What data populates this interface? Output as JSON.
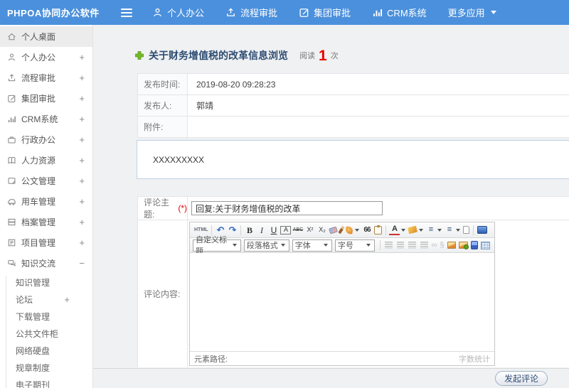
{
  "colors": {
    "header_blue": "#4b90dc",
    "title_navy": "#2e4d72",
    "count_red": "#e60000",
    "plus_green": "#6ab024"
  },
  "header": {
    "logo": "PHPOA协同办公软件",
    "nav": [
      {
        "label": "个人办公"
      },
      {
        "label": "流程审批"
      },
      {
        "label": "集团审批"
      },
      {
        "label": "CRM系统"
      },
      {
        "label": "更多应用"
      }
    ]
  },
  "sidebar": {
    "items": [
      {
        "label": "个人桌面",
        "expand": ""
      },
      {
        "label": "个人办公",
        "expand": "+"
      },
      {
        "label": "流程审批",
        "expand": "+"
      },
      {
        "label": "集团审批",
        "expand": "+"
      },
      {
        "label": "CRM系统",
        "expand": "+"
      },
      {
        "label": "行政办公",
        "expand": "+"
      },
      {
        "label": "人力资源",
        "expand": "+"
      },
      {
        "label": "公文管理",
        "expand": "+"
      },
      {
        "label": "用车管理",
        "expand": "+"
      },
      {
        "label": "档案管理",
        "expand": "+"
      },
      {
        "label": "项目管理",
        "expand": "+"
      },
      {
        "label": "知识交流",
        "expand": "−"
      }
    ],
    "subitems": [
      {
        "label": "知识管理",
        "expand": ""
      },
      {
        "label": "论坛",
        "expand": "+"
      },
      {
        "label": "下载管理",
        "expand": ""
      },
      {
        "label": "公共文件柜",
        "expand": ""
      },
      {
        "label": "网络硬盘",
        "expand": ""
      },
      {
        "label": "规章制度",
        "expand": ""
      },
      {
        "label": "电子期刊",
        "expand": ""
      }
    ]
  },
  "content": {
    "title": "关于财务增值税的改革信息浏览",
    "read_label": "阅读",
    "read_count": "1",
    "read_unit": "次",
    "info_rows": [
      {
        "label": "发布时间:",
        "value": "2019-08-20 09:28:23"
      },
      {
        "label": "发布人:",
        "value": "郭靖"
      },
      {
        "label": "附件:",
        "value": ""
      }
    ],
    "body_text": "XXXXXXXXX",
    "comment": {
      "subject_label": "评论主题:",
      "required_mark": "(*)",
      "subject_value": "回复:关于财务增值税的改革",
      "content_label": "评论内容:"
    },
    "submit_label": "发起评论"
  },
  "editor": {
    "html_button": "HTML",
    "bold": "B",
    "italic": "I",
    "underline": "U",
    "autotype": "A",
    "strike": "ABC",
    "superscript": "X²",
    "subscript": "X₂",
    "quote": "66",
    "font_color": "A",
    "dropdowns": [
      {
        "label": "自定义标题"
      },
      {
        "label": "段落格式"
      },
      {
        "label": "字体"
      },
      {
        "label": "字号"
      }
    ],
    "element_path_label": "元素路径:",
    "word_count_label": "字数统计"
  }
}
